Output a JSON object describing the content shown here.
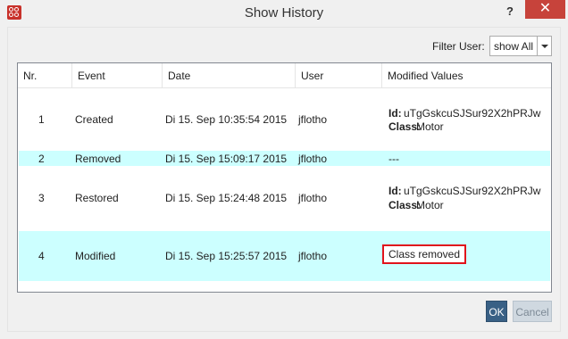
{
  "window": {
    "title": "Show History",
    "help": "?",
    "close": "✕"
  },
  "filter": {
    "label": "Filter User:",
    "value": "show All"
  },
  "table": {
    "headers": [
      "Nr.",
      "Event",
      "Date",
      "User",
      "Modified Values"
    ],
    "rows": [
      {
        "nr": "1",
        "event": "Created",
        "date": "Di 15. Sep 10:35:54 2015",
        "user": "jflotho",
        "id_label": "Id:",
        "id": "uTgGskcuSJSur92X2hPRJw",
        "class_label": "Class:",
        "class": "Motor"
      },
      {
        "nr": "2",
        "event": "Removed",
        "date": "Di 15. Sep 15:09:17 2015",
        "user": "jflotho",
        "value": "---"
      },
      {
        "nr": "3",
        "event": "Restored",
        "date": "Di 15. Sep 15:24:48 2015",
        "user": "jflotho",
        "id_label": "Id:",
        "id": "uTgGskcuSJSur92X2hPRJw",
        "class_label": "Class:",
        "class": "Motor"
      },
      {
        "nr": "4",
        "event": "Modified",
        "date": "Di 15. Sep 15:25:57 2015",
        "user": "jflotho",
        "value": "Class removed"
      }
    ]
  },
  "buttons": {
    "ok": "OK",
    "cancel": "Cancel"
  },
  "colors": {
    "row_alt": "#ccffff",
    "close": "#c7433b",
    "ok": "#396085",
    "highlight_border": "#e0141c"
  }
}
